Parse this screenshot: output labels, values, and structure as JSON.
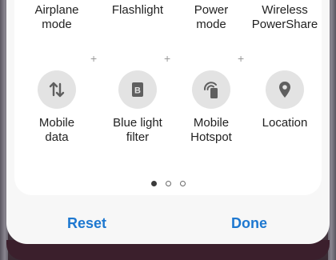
{
  "top_row": [
    {
      "label": "Airplane\nmode"
    },
    {
      "label": "Flashlight"
    },
    {
      "label": "Power\nmode"
    },
    {
      "label": "Wireless\nPowerShare"
    }
  ],
  "add_glyph": "+",
  "tiles": [
    {
      "label": "Mobile\ndata",
      "icon": "data-arrows-icon"
    },
    {
      "label": "Blue light\nfilter",
      "icon": "blue-light-filter-icon",
      "icon_letter": "B"
    },
    {
      "label": "Mobile\nHotspot",
      "icon": "hotspot-icon"
    },
    {
      "label": "Location",
      "icon": "location-pin-icon"
    }
  ],
  "pagination": {
    "total": 3,
    "active_index": 0
  },
  "footer": {
    "reset_label": "Reset",
    "done_label": "Done"
  },
  "colors": {
    "accent": "#1e78d0",
    "icon_bg": "#e3e3e3",
    "icon_fg": "#5f5f5f"
  }
}
